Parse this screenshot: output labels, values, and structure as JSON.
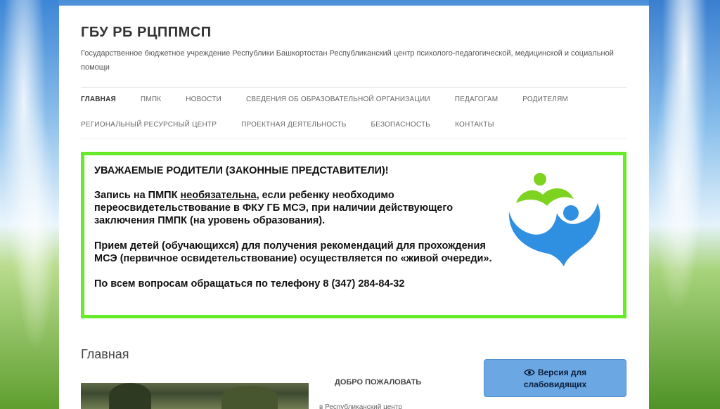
{
  "site": {
    "title": "ГБУ РБ РЦППМСП",
    "description": "Государственное бюджетное учреждение Республики Башкортостан Республиканский центр психолого-педагогической, медицинской и социальной помощи"
  },
  "nav": {
    "row1": [
      "Главная",
      "ПМПК",
      "Новости",
      "Сведения об образовательной организации",
      "Педагогам",
      "Родителям"
    ],
    "row2": [
      "Региональный ресурсный центр",
      "Проектная деятельность",
      "Безопасность",
      "Контакты"
    ],
    "active": "Главная"
  },
  "banner": {
    "heading": "УВАЖАЕМЫЕ РОДИТЕЛИ  (ЗАКОННЫЕ ПРЕДСТАВИТЕЛИ)!",
    "p1_before": "Запись на ПМПК ",
    "p1_underlined": "необязательна",
    "p1_after": ", если ребенку необходимо переосвидетельствование в ФКУ ГБ МСЭ, при наличии действующего  заключения ПМПК (на уровень образования).",
    "p2": "Прием детей (обучающихся) для получения рекомендаций  для прохождения МСЭ (первичное освидетельствование) осуществляется по «живой очереди».",
    "p3": "По всем вопросам обращаться по телефону 8 (347) 284-84-32",
    "colors": {
      "border": "#66ea2a",
      "logo_green": "#7ed321",
      "logo_blue": "#2f8fe0"
    }
  },
  "main": {
    "heading": "Главная",
    "welcome_title": "ДОБРО ПОЖАЛОВАТЬ",
    "welcome_text": "в Республиканский центр"
  },
  "accessibility": {
    "label_line1": "Версия для",
    "label_line2": "слабовидящих",
    "icon": "eye-icon"
  }
}
